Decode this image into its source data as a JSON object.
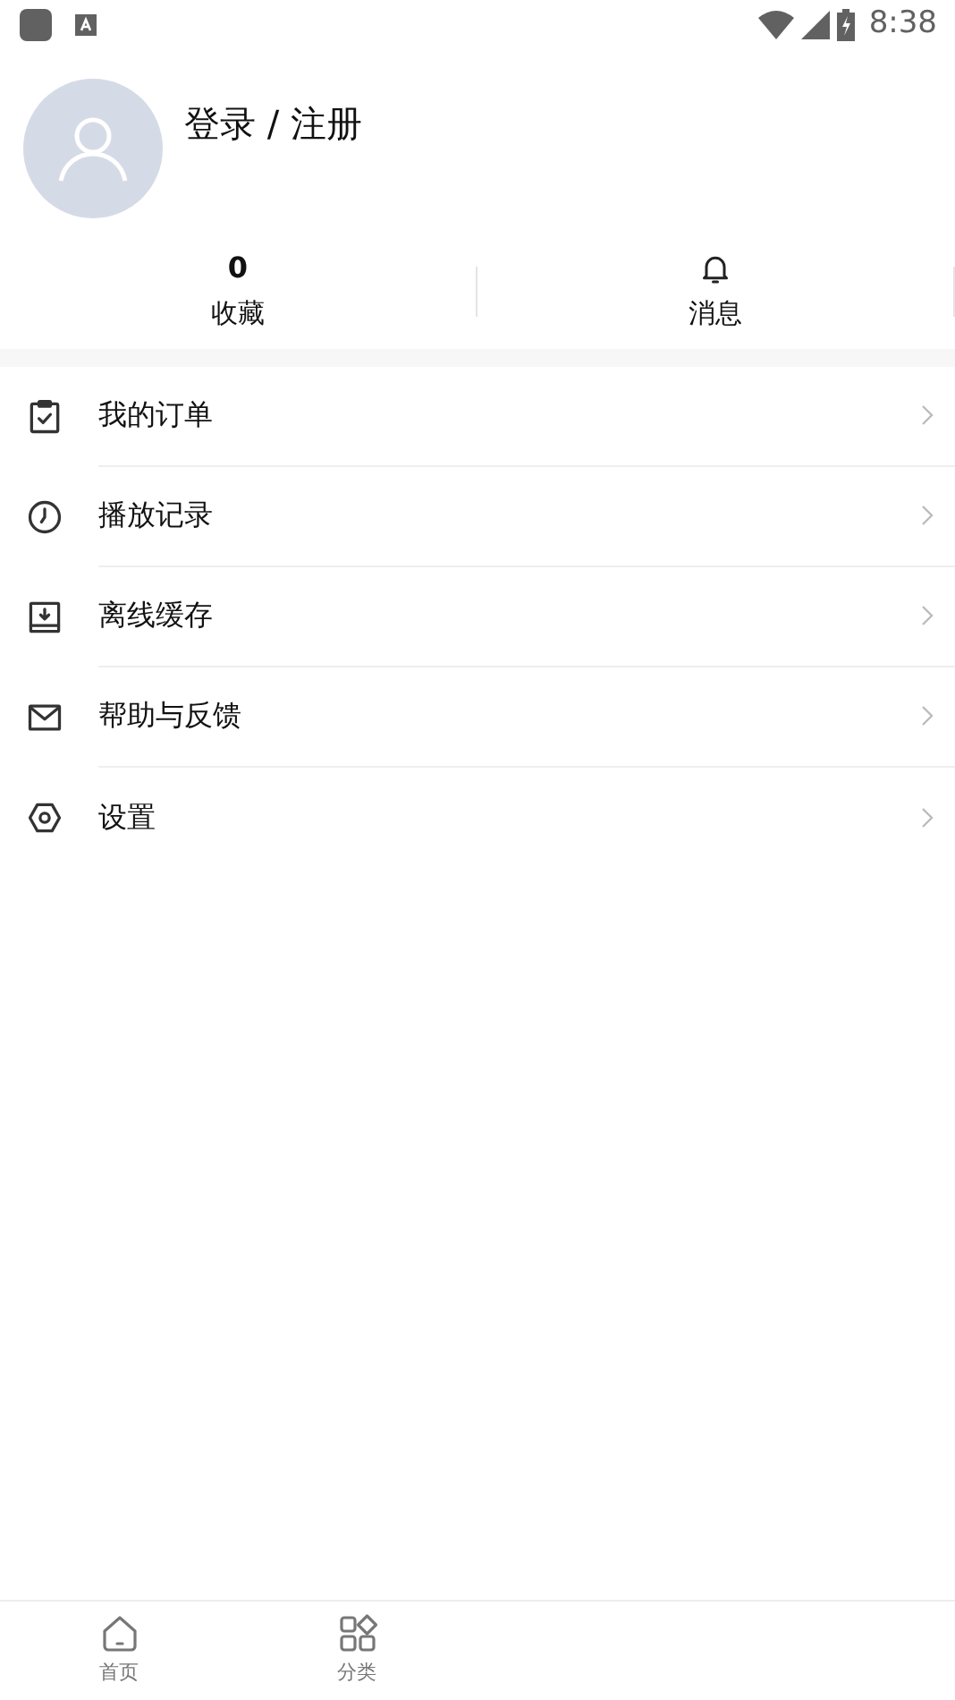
{
  "status_bar": {
    "time": "8:38"
  },
  "profile": {
    "login_label": "登录 / 注册"
  },
  "stats": [
    {
      "kind": "count",
      "value": "0",
      "label": "收藏"
    },
    {
      "kind": "bell",
      "label": "消息"
    }
  ],
  "menu": [
    {
      "kind": "order",
      "label": "我的订单"
    },
    {
      "kind": "history",
      "label": "播放记录"
    },
    {
      "kind": "download",
      "label": "离线缓存"
    },
    {
      "kind": "mail",
      "label": "帮助与反馈"
    },
    {
      "kind": "settings",
      "label": "设置"
    }
  ],
  "bottom_nav": [
    {
      "kind": "home",
      "label": "首页",
      "selected": false
    },
    {
      "kind": "category",
      "label": "分类",
      "selected": false
    }
  ]
}
